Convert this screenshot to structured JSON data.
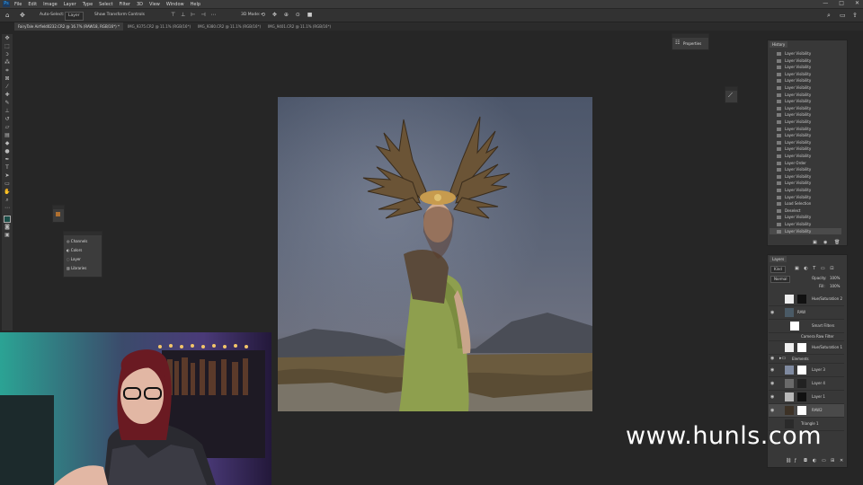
{
  "menubar": {
    "items": [
      "File",
      "Edit",
      "Image",
      "Layer",
      "Type",
      "Select",
      "Filter",
      "3D",
      "View",
      "Window",
      "Help"
    ],
    "window_controls": [
      "—",
      "□",
      "✕"
    ]
  },
  "options": {
    "auto_select_label": "Auto-Select:",
    "auto_select_value": "Layer",
    "show_transform_label": "Show Transform Controls",
    "mode_label": "3D Mode:"
  },
  "tabs": [
    "FairyTale Airfield0232.CR2 @ 16.7% (RAW18, RGB/16*) *",
    "IMG_9375.CR2 @ 11.1% (RGB/16*)",
    "IMG_9380.CR2 @ 11.1% (RGB/16*)",
    "IMG_9401.CR2 @ 11.1% (RGB/16*)"
  ],
  "properties_panel": {
    "label": "Properties"
  },
  "mini_panel": {
    "items": [
      "Channels",
      "Colors",
      "Layer",
      "Libraries"
    ]
  },
  "history": {
    "tab": "History",
    "items": [
      "Layer Visibility",
      "Layer Visibility",
      "Layer Visibility",
      "Layer Visibility",
      "Layer Visibility",
      "Layer Visibility",
      "Layer Visibility",
      "Layer Visibility",
      "Layer Visibility",
      "Layer Visibility",
      "Layer Visibility",
      "Layer Visibility",
      "Layer Visibility",
      "Layer Visibility",
      "Layer Visibility",
      "Layer Visibility",
      "Layer Order",
      "Layer Visibility",
      "Layer Visibility",
      "Layer Visibility",
      "Layer Visibility",
      "Layer Visibility",
      "Load Selection",
      "Deselect",
      "Layer Visibility",
      "Layer Visibility",
      "Layer Visibility"
    ]
  },
  "layers": {
    "tab": "Layers",
    "filter_label": "Kind",
    "blend_mode": "Normal",
    "opacity_label": "Opacity:",
    "opacity_value": "100%",
    "fill_label": "Fill:",
    "fill_value": "100%",
    "rows": [
      {
        "name": "Hue/Saturation 2"
      },
      {
        "name": "RAW"
      },
      {
        "name": "Smart Filters"
      },
      {
        "name": "Camera Raw Filter"
      },
      {
        "name": "Hue/Saturation 1"
      },
      {
        "name": "Elements"
      },
      {
        "name": "Layer 3"
      },
      {
        "name": "Layer 4"
      },
      {
        "name": "Layer 1"
      },
      {
        "name": "RAW2"
      },
      {
        "name": "Triangle 1"
      }
    ]
  },
  "watermark": "www.hunls.com",
  "colors": {
    "accent": "#31a8ff",
    "app_bg": "#262626",
    "panel_bg": "#383838"
  }
}
